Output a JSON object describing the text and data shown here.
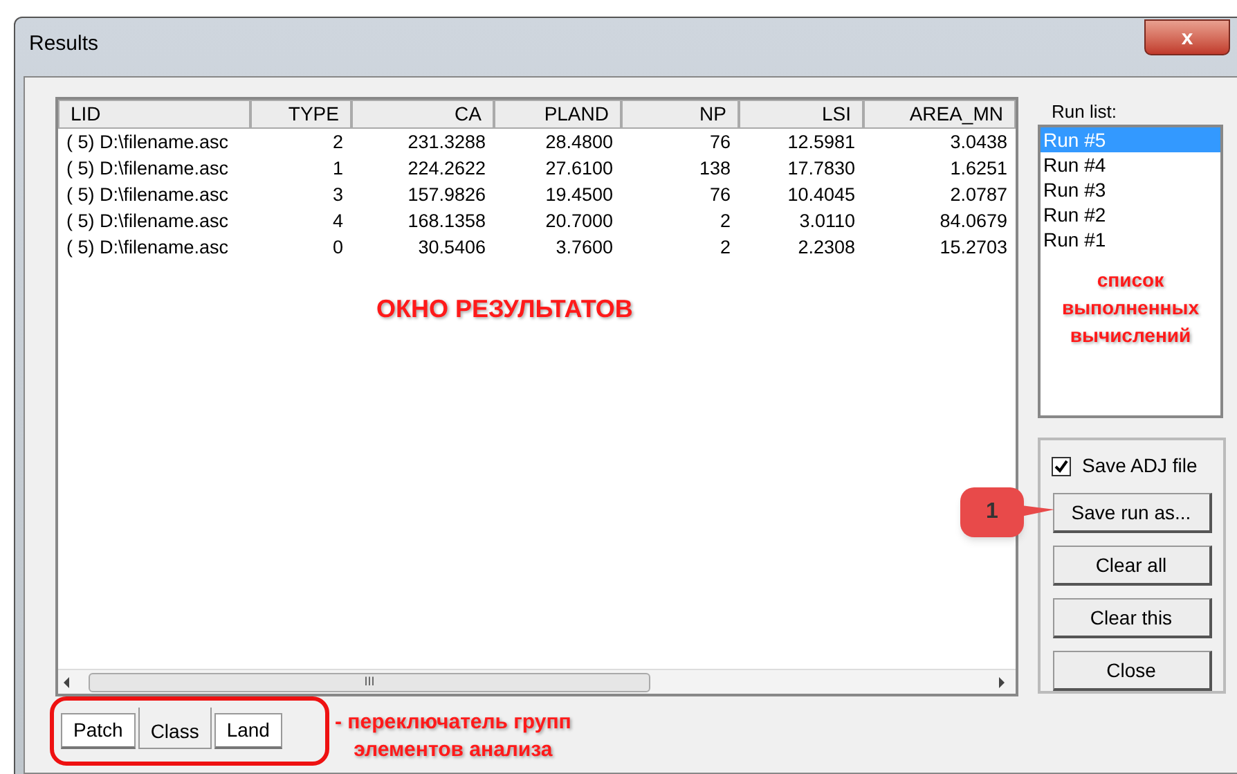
{
  "window": {
    "title": "Results",
    "close_label": "x"
  },
  "table": {
    "columns": [
      "LID",
      "TYPE",
      "CA",
      "PLAND",
      "NP",
      "LSI",
      "AREA_MN"
    ],
    "rows": [
      [
        "( 5) D:\\filename.asc",
        "2",
        "231.3288",
        "28.4800",
        "76",
        "12.5981",
        "3.0438"
      ],
      [
        "( 5) D:\\filename.asc",
        "1",
        "224.2622",
        "27.6100",
        "138",
        "17.7830",
        "1.6251"
      ],
      [
        "( 5) D:\\filename.asc",
        "3",
        "157.9826",
        "19.4500",
        "76",
        "10.4045",
        "2.0787"
      ],
      [
        "( 5) D:\\filename.asc",
        "4",
        "168.1358",
        "20.7000",
        "2",
        "3.0110",
        "84.0679"
      ],
      [
        "( 5) D:\\filename.asc",
        "0",
        "30.5406",
        "3.7600",
        "2",
        "2.2308",
        "15.2703"
      ]
    ],
    "scroll_grip": "III"
  },
  "run_list": {
    "label": "Run list:",
    "items": [
      {
        "label": "Run #5",
        "selected": true
      },
      {
        "label": "Run #4",
        "selected": false
      },
      {
        "label": "Run #3",
        "selected": false
      },
      {
        "label": "Run #2",
        "selected": false
      },
      {
        "label": "Run #1",
        "selected": false
      }
    ]
  },
  "save_adj": {
    "label": "Save ADJ file",
    "checked": true
  },
  "buttons": [
    "Save run as...",
    "Clear all",
    "Clear this",
    "Close"
  ],
  "tabs": [
    {
      "label": "Patch",
      "selected": false
    },
    {
      "label": "Class",
      "selected": true
    },
    {
      "label": "Land",
      "selected": false
    }
  ],
  "annotations": {
    "results_window": "ОКНО РЕЗУЛЬТАТОВ",
    "run_list_note": [
      "список",
      "выполненных",
      "вычислений"
    ],
    "callout_number": "1",
    "tabs_note": [
      "- переключатель групп",
      "элементов анализа"
    ]
  }
}
